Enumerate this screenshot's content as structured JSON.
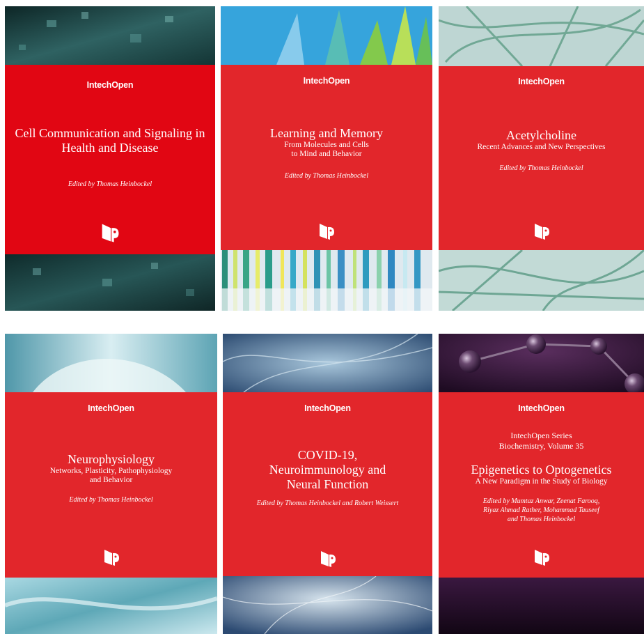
{
  "publisher_name": "IntechOpen",
  "covers": [
    {
      "title_lines": [
        "Cell Communication and Signaling in",
        "Health and Disease"
      ],
      "subtitle_lines": [],
      "series_lines": [],
      "editor_lines": [
        "Edited by Thomas Heinbockel"
      ]
    },
    {
      "title_lines": [
        "Learning and Memory"
      ],
      "subtitle_lines": [
        "From Molecules and Cells",
        "to Mind and Behavior"
      ],
      "series_lines": [],
      "editor_lines": [
        "Edited by Thomas Heinbockel"
      ]
    },
    {
      "title_lines": [
        "Acetylcholine"
      ],
      "subtitle_lines": [
        "Recent Advances and New Perspectives"
      ],
      "series_lines": [],
      "editor_lines": [
        "Edited by Thomas Heinbockel"
      ]
    },
    {
      "title_lines": [
        "Neurophysiology"
      ],
      "subtitle_lines": [
        "Networks, Plasticity, Pathophysiology",
        "and Behavior"
      ],
      "series_lines": [],
      "editor_lines": [
        "Edited by Thomas Heinbockel"
      ]
    },
    {
      "title_lines": [
        "COVID-19,",
        "Neuroimmunology and",
        "Neural Function"
      ],
      "subtitle_lines": [],
      "series_lines": [],
      "editor_lines": [
        "Edited by Thomas Heinbockel and Robert Weissert"
      ]
    },
    {
      "title_lines": [
        "Epigenetics to Optogenetics"
      ],
      "subtitle_lines": [
        "A New Paradigm in the Study of Biology"
      ],
      "series_lines": [
        "IntechOpen Series",
        "Biochemistry, Volume 35"
      ],
      "editor_lines": [
        "Edited by Mumtaz Anwar, Zeenat Farooq,",
        "Riyaz Ahmad Rather, Mohammad Tauseef",
        "and Thomas Heinbockel"
      ]
    }
  ],
  "colors": {
    "cover_red_1": "#e10613",
    "cover_red": "#e2262b",
    "text": "#ffffff"
  },
  "icons": [
    "intechopen-logo-icon"
  ]
}
